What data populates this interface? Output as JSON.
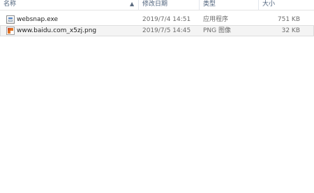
{
  "columns": {
    "name": "名称",
    "date": "修改日期",
    "type": "类型",
    "size": "大小"
  },
  "sort": {
    "indicator": "▲",
    "icon": "sort-ascending-icon"
  },
  "files": [
    {
      "name": "websnap.exe",
      "date": "2019/7/4 14:51",
      "type": "应用程序",
      "size": "751 KB",
      "icon": "exe-icon"
    },
    {
      "name": "www.baidu.com_x5zj.png",
      "date": "2019/7/5 14:45",
      "type": "PNG 图像",
      "size": "32 KB",
      "icon": "png-icon",
      "selected": true
    }
  ],
  "colors": {
    "header_text": "#4c607a",
    "row_text": "#1e1e1e",
    "secondary_text": "#6d6d6d",
    "selection_bg": "#f4f4f4"
  }
}
